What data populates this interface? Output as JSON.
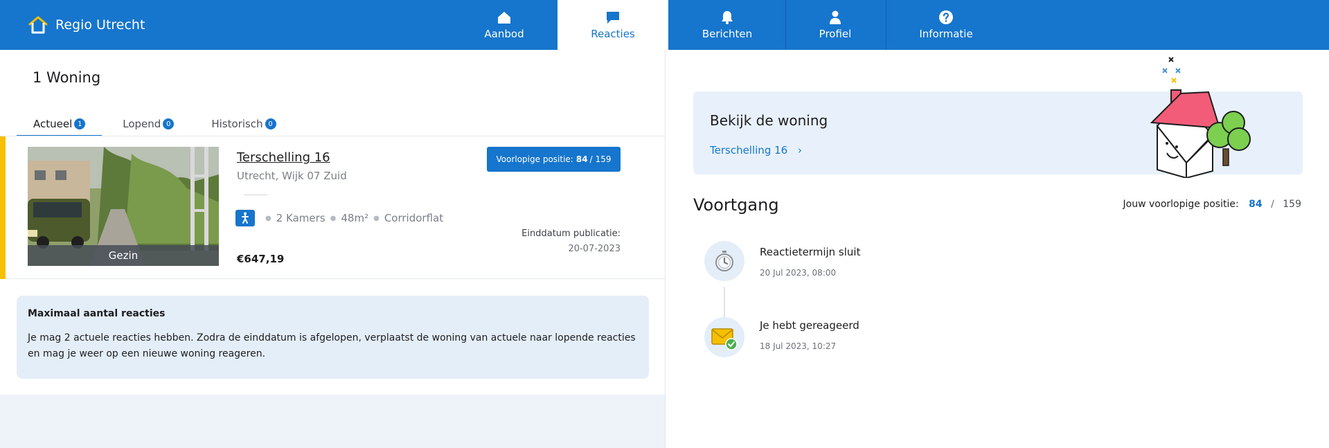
{
  "header": {
    "brand": "Regio Utrecht",
    "nav": [
      {
        "label": "Aanbod",
        "icon": "home-icon",
        "active": false
      },
      {
        "label": "Reacties",
        "icon": "chat-icon",
        "active": true
      },
      {
        "label": "Berichten",
        "icon": "bell-icon",
        "active": false
      },
      {
        "label": "Profiel",
        "icon": "user-icon",
        "active": false
      },
      {
        "label": "Informatie",
        "icon": "question-icon",
        "active": false
      }
    ]
  },
  "left": {
    "title": "1 Woning",
    "tabs": [
      {
        "label": "Actueel",
        "count": "1",
        "active": true
      },
      {
        "label": "Lopend",
        "count": "0",
        "active": false
      },
      {
        "label": "Historisch",
        "count": "0",
        "active": false
      }
    ],
    "listing": {
      "photo_label": "Gezin",
      "address": "Terschelling 16",
      "city": "Utrecht, Wijk 07 Zuid",
      "features": [
        "2 Kamers",
        "48m²",
        "Corridorflat"
      ],
      "feature_icon": "accessible-person-icon",
      "price": "€647,19",
      "position_label": "Voorlopige positie:",
      "position": "84",
      "position_sep": "/",
      "position_total": "159",
      "end_label": "Einddatum publicatie:",
      "end_date": "20-07-2023"
    },
    "info": {
      "title": "Maximaal aantal reacties",
      "text": "Je mag 2 actuele reacties hebben. Zodra de einddatum is afgelopen, verplaatst de woning van actuele naar lopende reacties en mag je weer op een nieuwe woning reageren."
    }
  },
  "right": {
    "view_title": "Bekijk de woning",
    "view_link": "Terschelling 16",
    "progress_title": "Voortgang",
    "your_position_label": "Jouw voorlopige positie:",
    "your_position": "84",
    "your_position_sep": "/",
    "your_position_total": "159",
    "steps": [
      {
        "title": "Reactietermijn sluit",
        "date": "20 Jul 2023, 08:00",
        "icon": "stopwatch-icon"
      },
      {
        "title": "Je hebt gereageerd",
        "date": "18 Jul 2023, 10:27",
        "icon": "envelope-check-icon"
      }
    ]
  },
  "colors": {
    "brand": "#1675cc",
    "accent": "#f6c000",
    "panel": "#e4eef9"
  }
}
